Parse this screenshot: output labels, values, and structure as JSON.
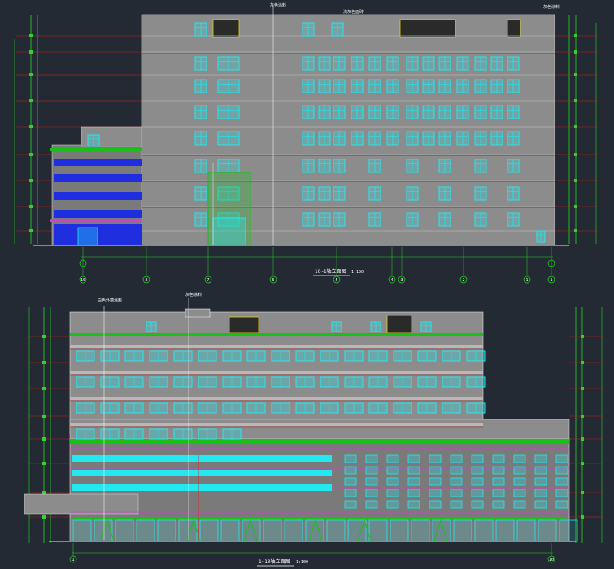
{
  "colors": {
    "background": "#232a33",
    "wall": "#8c8c8c",
    "window": "#22e8f0",
    "frame": "#18c018",
    "level": "#c81e1e",
    "dim": "#2bd52b",
    "text": "#ffffff",
    "blue_band": "#1f2fe0",
    "roof_yellow": "#e6d21c",
    "magenta": "#d040d0"
  },
  "icons": [
    "axis-bubble-icon",
    "elevation-mark-icon"
  ],
  "top_elevation": {
    "title": "10~1轴立面图",
    "scale": "1:100",
    "axis_labels": [
      "10",
      "8",
      "7",
      "6",
      "5",
      "4",
      "3",
      "2",
      "1"
    ],
    "notes": [
      "灰色涂料",
      "浅灰色面砖",
      "灰色涂料"
    ]
  },
  "bottom_elevation": {
    "title": "1~10轴立面图",
    "scale": "1:100",
    "axis_labels": [
      "1",
      "10"
    ],
    "notes": [
      "白色外墙涂料",
      "灰色涂料"
    ]
  }
}
